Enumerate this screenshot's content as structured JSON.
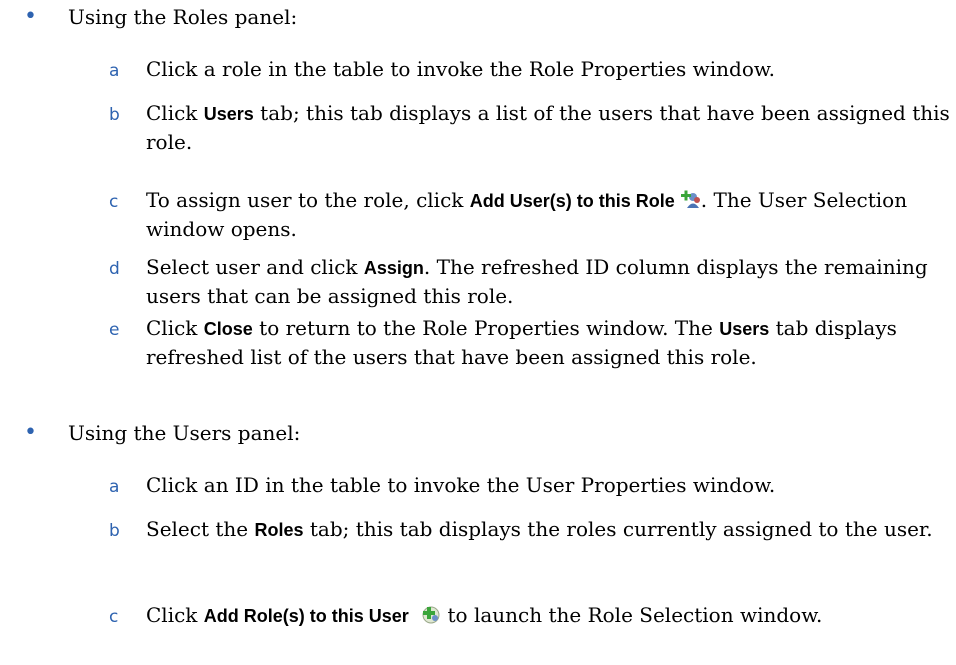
{
  "sections": [
    {
      "label": "Using the Roles panel:",
      "steps": [
        {
          "letter": "a",
          "parts": [
            {
              "t": "Click a role in the table to invoke the Role Properties window."
            }
          ]
        },
        {
          "letter": "b",
          "parts": [
            {
              "t": "Click "
            },
            {
              "b": "Users"
            },
            {
              "t": " tab; this tab displays a list of the users that have been assigned this role."
            }
          ]
        },
        {
          "letter": "c",
          "parts": [
            {
              "t": "To assign user to the role, click "
            },
            {
              "b": "Add User(s) to this Role"
            },
            {
              "icon": "add-users-icon"
            },
            {
              "t": ". The User Selection window opens."
            }
          ]
        },
        {
          "letter": "d",
          "parts": [
            {
              "t": "Select user and click "
            },
            {
              "b": "Assign"
            },
            {
              "t": ". The refreshed ID column displays the remaining users that can be assigned this role."
            }
          ]
        },
        {
          "letter": "e",
          "parts": [
            {
              "t": "Click "
            },
            {
              "b": "Close"
            },
            {
              "t": " to return to the Role Properties window. The "
            },
            {
              "b": "Users"
            },
            {
              "t": " tab displays refreshed list of the users that have been assigned this role."
            }
          ]
        }
      ]
    },
    {
      "label": "Using the Users panel:",
      "steps": [
        {
          "letter": "a",
          "parts": [
            {
              "t": "Click an ID in the table to invoke the User Properties window."
            }
          ]
        },
        {
          "letter": "b",
          "parts": [
            {
              "t": "Select the "
            },
            {
              "b": "Roles"
            },
            {
              "t": " tab; this tab displays the roles currently assigned to the user."
            }
          ]
        },
        {
          "letter": "c",
          "parts": [
            {
              "t": "Click "
            },
            {
              "b": "Add Role(s) to this User"
            },
            {
              "t": " "
            },
            {
              "icon": "add-role-icon"
            },
            {
              "t": " to launch the Role Selection window."
            }
          ]
        }
      ]
    }
  ],
  "colors": {
    "accent": "#2e63b0",
    "icon_green": "#3aa53a"
  }
}
